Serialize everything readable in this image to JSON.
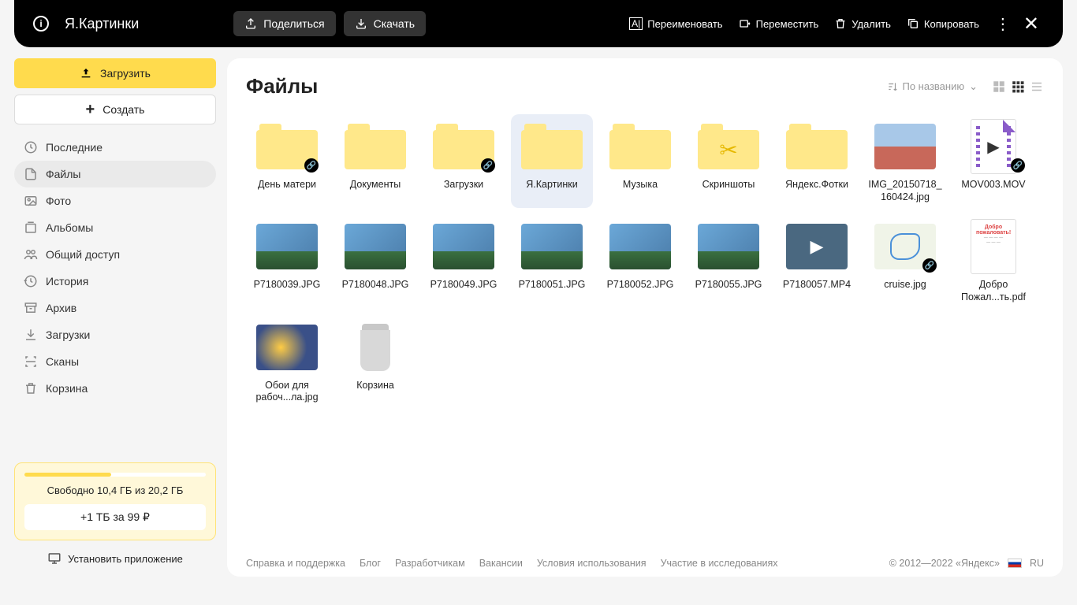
{
  "topbar": {
    "title": "Я.Картинки",
    "share": "Поделиться",
    "download": "Скачать",
    "rename": "Переименовать",
    "move": "Переместить",
    "delete": "Удалить",
    "copy": "Копировать"
  },
  "sidebar": {
    "upload": "Загрузить",
    "create": "Создать",
    "nav": [
      {
        "key": "recent",
        "label": "Последние"
      },
      {
        "key": "files",
        "label": "Файлы"
      },
      {
        "key": "photo",
        "label": "Фото"
      },
      {
        "key": "albums",
        "label": "Альбомы"
      },
      {
        "key": "shared",
        "label": "Общий доступ"
      },
      {
        "key": "history",
        "label": "История"
      },
      {
        "key": "archive",
        "label": "Архив"
      },
      {
        "key": "downloads",
        "label": "Загрузки"
      },
      {
        "key": "scans",
        "label": "Сканы"
      },
      {
        "key": "trash",
        "label": "Корзина"
      }
    ],
    "storage": {
      "text": "Свободно 10,4 ГБ из 20,2 ГБ",
      "upgrade": "+1 ТБ за 99 ₽"
    },
    "install": "Установить приложение"
  },
  "content": {
    "heading": "Файлы",
    "sort": "По названию",
    "items": [
      {
        "type": "folder",
        "label": "День матери",
        "shared": true
      },
      {
        "type": "folder",
        "label": "Документы"
      },
      {
        "type": "folder",
        "label": "Загрузки",
        "shared": true
      },
      {
        "type": "folder",
        "label": "Я.Картинки",
        "selected": true
      },
      {
        "type": "folder",
        "label": "Музыка"
      },
      {
        "type": "folder",
        "label": "Скриншоты",
        "variant": "scissors"
      },
      {
        "type": "folder",
        "label": "Яндекс.Фотки"
      },
      {
        "type": "image",
        "label": "IMG_20150718_160424.jpg",
        "variant": "tallinn"
      },
      {
        "type": "video-doc",
        "label": "MOV003.MOV",
        "shared": true
      },
      {
        "type": "image",
        "label": "P7180039.JPG",
        "variant": "city"
      },
      {
        "type": "image",
        "label": "P7180048.JPG",
        "variant": "city"
      },
      {
        "type": "image",
        "label": "P7180049.JPG",
        "variant": "city"
      },
      {
        "type": "image",
        "label": "P7180051.JPG",
        "variant": "city"
      },
      {
        "type": "image",
        "label": "P7180052.JPG",
        "variant": "city"
      },
      {
        "type": "image",
        "label": "P7180055.JPG",
        "variant": "city"
      },
      {
        "type": "video",
        "label": "P7180057.MP4"
      },
      {
        "type": "image",
        "label": "cruise.jpg",
        "variant": "map",
        "shared": true
      },
      {
        "type": "pdf",
        "label": "Добро Пожал...ть.pdf"
      },
      {
        "type": "image",
        "label": "Обои для рабоч...ла.jpg",
        "variant": "abstract"
      },
      {
        "type": "trash",
        "label": "Корзина"
      }
    ]
  },
  "footer": {
    "links": [
      "Справка и поддержка",
      "Блог",
      "Разработчикам",
      "Вакансии",
      "Условия использования",
      "Участие в исследованиях"
    ],
    "copyright": "© 2012—2022  «Яндекс»",
    "lang": "RU"
  }
}
